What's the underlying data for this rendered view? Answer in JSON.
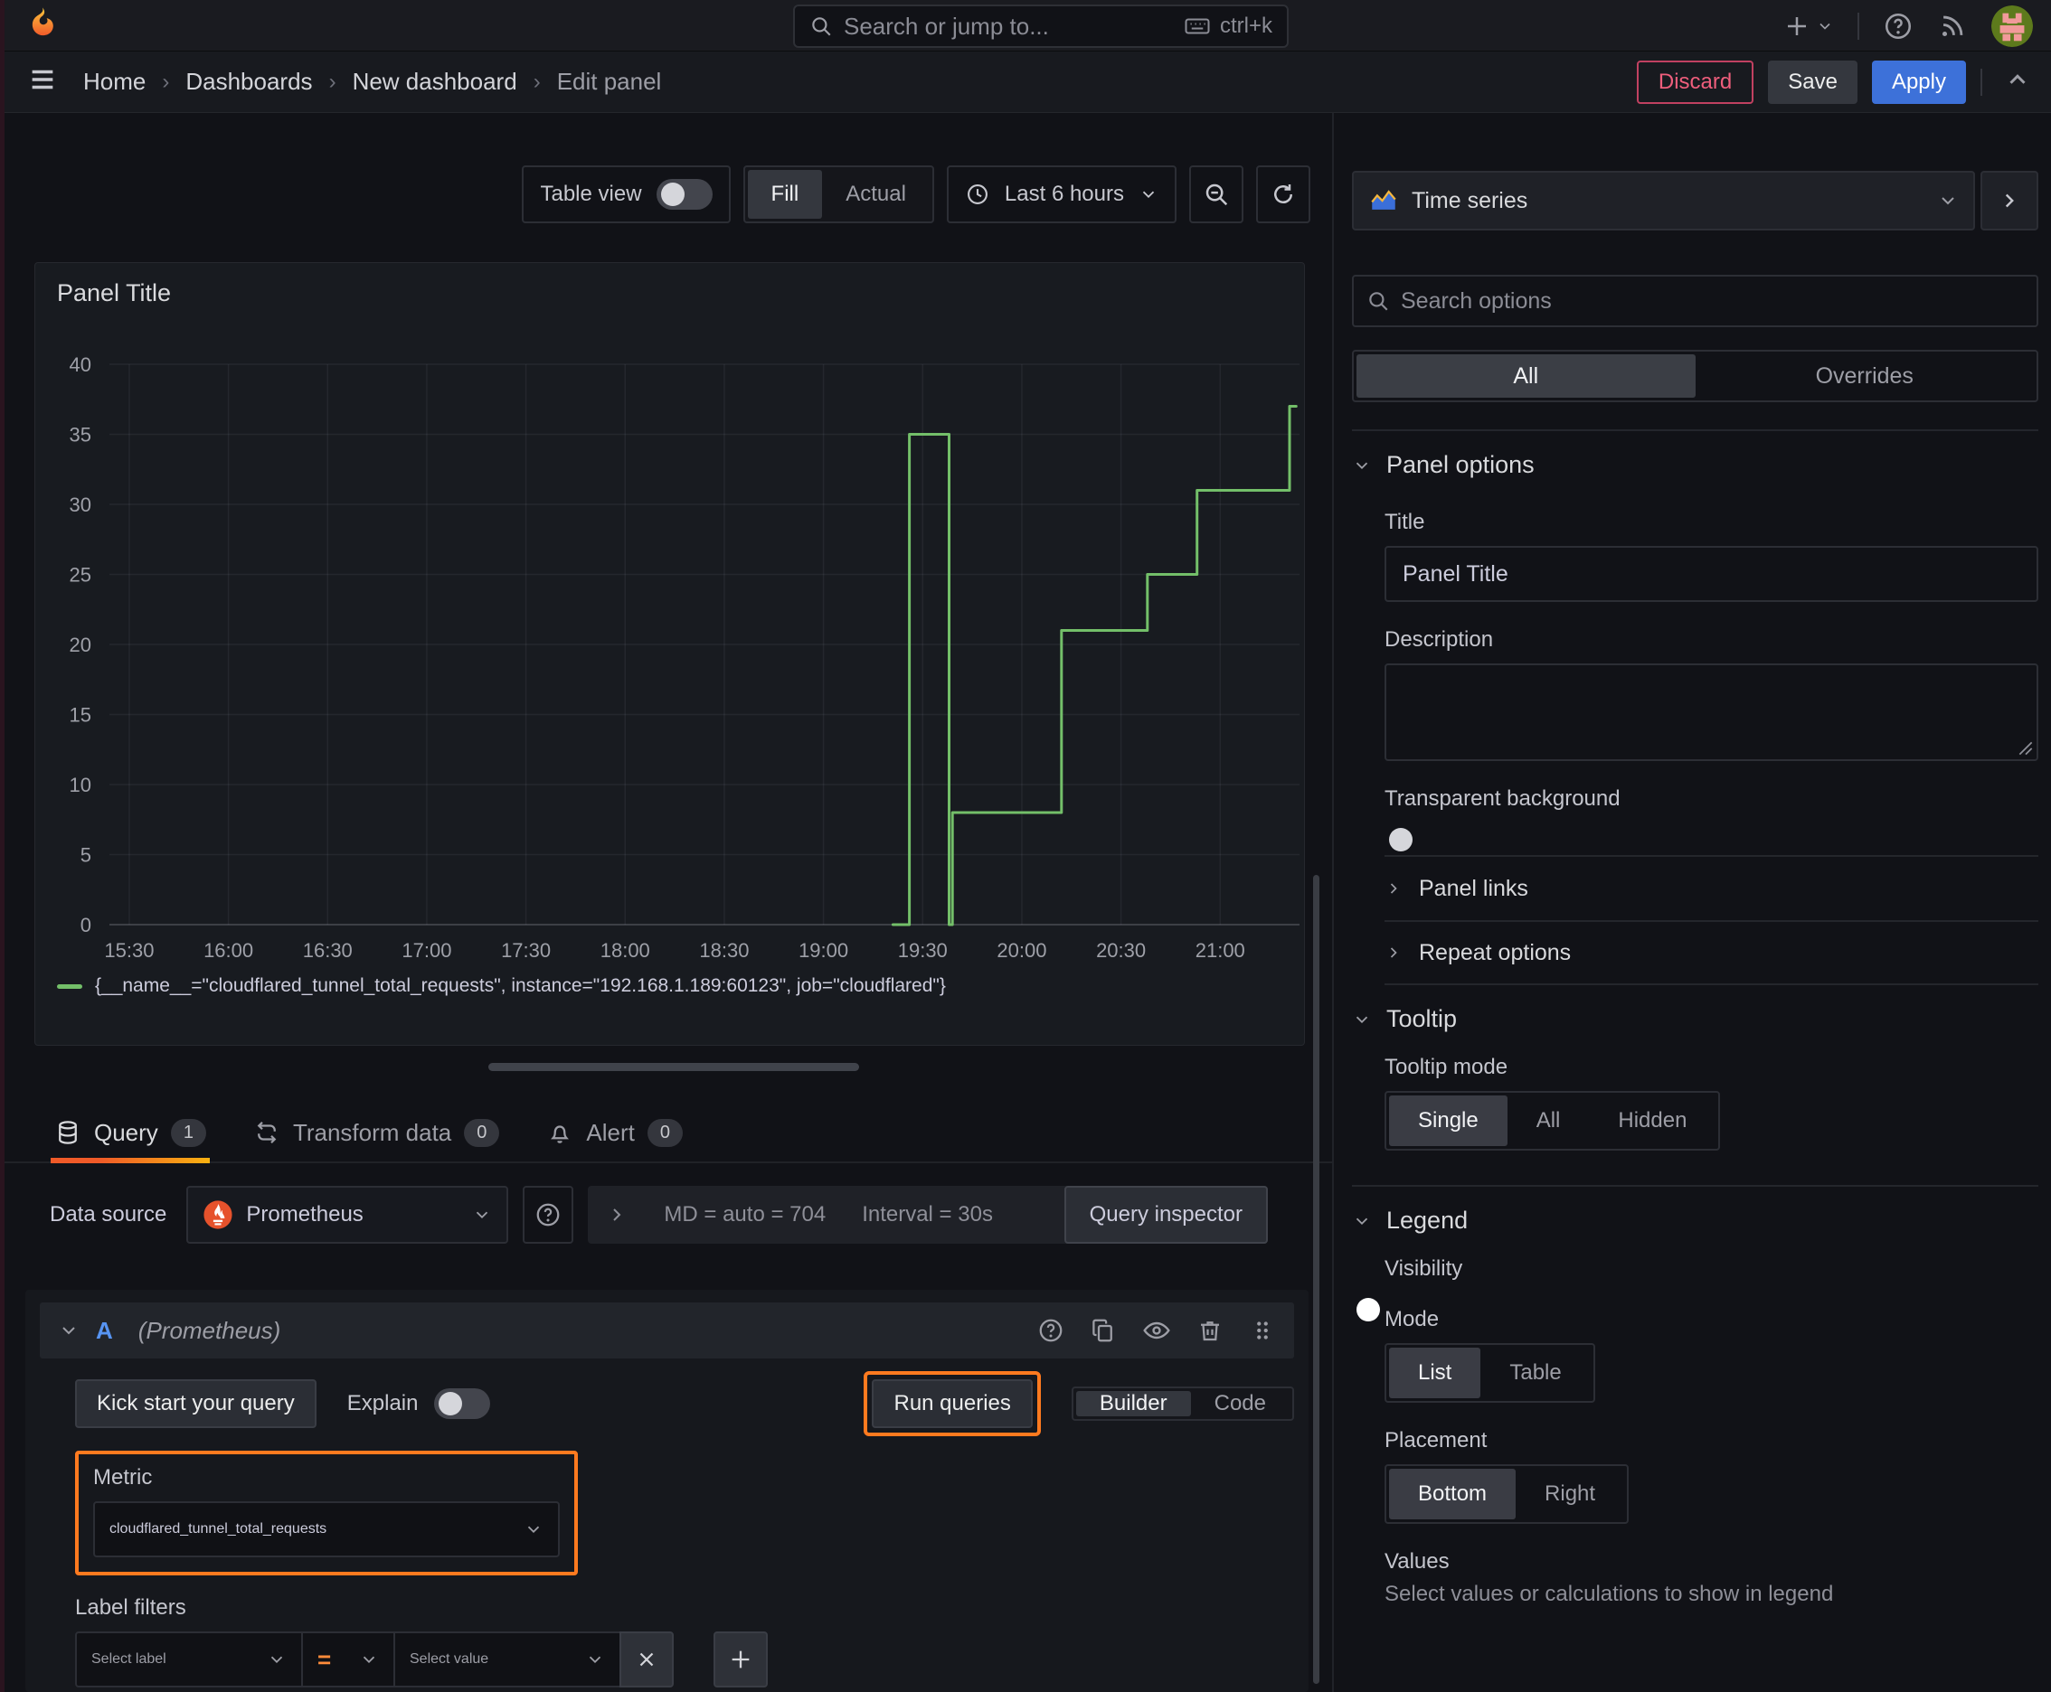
{
  "topnav": {
    "search_placeholder": "Search or jump to...",
    "search_shortcut": "ctrl+k"
  },
  "breadcrumb": {
    "separator": "›",
    "items": [
      "Home",
      "Dashboards",
      "New dashboard",
      "Edit panel"
    ]
  },
  "header_actions": {
    "discard": "Discard",
    "save": "Save",
    "apply": "Apply"
  },
  "toolbar": {
    "table_view_label": "Table view",
    "table_view_on": false,
    "display_modes": [
      "Fill",
      "Actual"
    ],
    "display_mode_selected": "Fill",
    "time_range": "Last 6 hours"
  },
  "panel": {
    "title": "Panel Title"
  },
  "chart_data": {
    "type": "line",
    "interpolation": "step-after",
    "title": "Panel Title",
    "x_domain": [
      "15:24",
      "21:24"
    ],
    "x_end": "21:23",
    "x_ticks": [
      "15:30",
      "16:00",
      "16:30",
      "17:00",
      "17:30",
      "18:00",
      "18:30",
      "19:00",
      "19:30",
      "20:00",
      "20:30",
      "21:00"
    ],
    "ylim": [
      0,
      40
    ],
    "y_ticks": [
      0,
      5,
      10,
      15,
      20,
      25,
      30,
      35,
      40
    ],
    "grid": true,
    "legend_position": "bottom",
    "series": [
      {
        "name": "{__name__=\"cloudflared_tunnel_total_requests\", instance=\"192.168.1.189:60123\", job=\"cloudflared\"}",
        "color": "#73bf69",
        "points": [
          [
            "19:21",
            0
          ],
          [
            "19:26",
            35
          ],
          [
            "19:38",
            0
          ],
          [
            "19:39",
            8
          ],
          [
            "20:12",
            21
          ],
          [
            "20:38",
            25
          ],
          [
            "20:53",
            31
          ],
          [
            "21:21",
            37
          ]
        ]
      }
    ]
  },
  "tabs": [
    {
      "label": "Query",
      "count": "1"
    },
    {
      "label": "Transform data",
      "count": "0"
    },
    {
      "label": "Alert",
      "count": "0"
    }
  ],
  "datasource_bar": {
    "label": "Data source",
    "selected": "Prometheus",
    "max_data_points": "MD = auto = 704",
    "interval": "Interval = 30s",
    "inspector_label": "Query inspector"
  },
  "query_editor": {
    "ref_id": "A",
    "datasource_hint": "(Prometheus)",
    "kickstart_label": "Kick start your query",
    "explain_label": "Explain",
    "explain_on": false,
    "run_label": "Run queries",
    "editor_modes": [
      "Builder",
      "Code"
    ],
    "editor_mode_selected": "Builder",
    "metric_label": "Metric",
    "metric_value": "cloudflared_tunnel_total_requests",
    "label_filters_label": "Label filters",
    "select_label_placeholder": "Select label",
    "operator": "=",
    "select_value_placeholder": "Select value"
  },
  "sidebar": {
    "visualization": "Time series",
    "search_placeholder": "Search options",
    "filter_tabs": [
      "All",
      "Overrides"
    ],
    "filter_tab_selected": "All",
    "panel_options": {
      "header": "Panel options",
      "title_label": "Title",
      "title_value": "Panel Title",
      "description_label": "Description",
      "transparent_label": "Transparent background",
      "transparent_on": false
    },
    "collapsed_sections": [
      "Panel links",
      "Repeat options"
    ],
    "tooltip": {
      "header": "Tooltip",
      "mode_label": "Tooltip mode",
      "modes": [
        "Single",
        "All",
        "Hidden"
      ],
      "mode_selected": "Single"
    },
    "legend": {
      "header": "Legend",
      "visibility_label": "Visibility",
      "visibility_on": true,
      "mode_label": "Mode",
      "modes": [
        "List",
        "Table"
      ],
      "mode_selected": "List",
      "placement_label": "Placement",
      "placements": [
        "Bottom",
        "Right"
      ],
      "placement_selected": "Bottom",
      "values_label": "Values",
      "values_hint": "Select values or calculations to show in legend"
    }
  },
  "colors": {
    "accent_orange": "#ff7a1f",
    "tab_underline_from": "#f05a28",
    "tab_underline_to": "#fbca0a",
    "apply_blue": "#3d71d9",
    "discard_pink": "#ef5e7c",
    "series_green": "#73bf69"
  }
}
